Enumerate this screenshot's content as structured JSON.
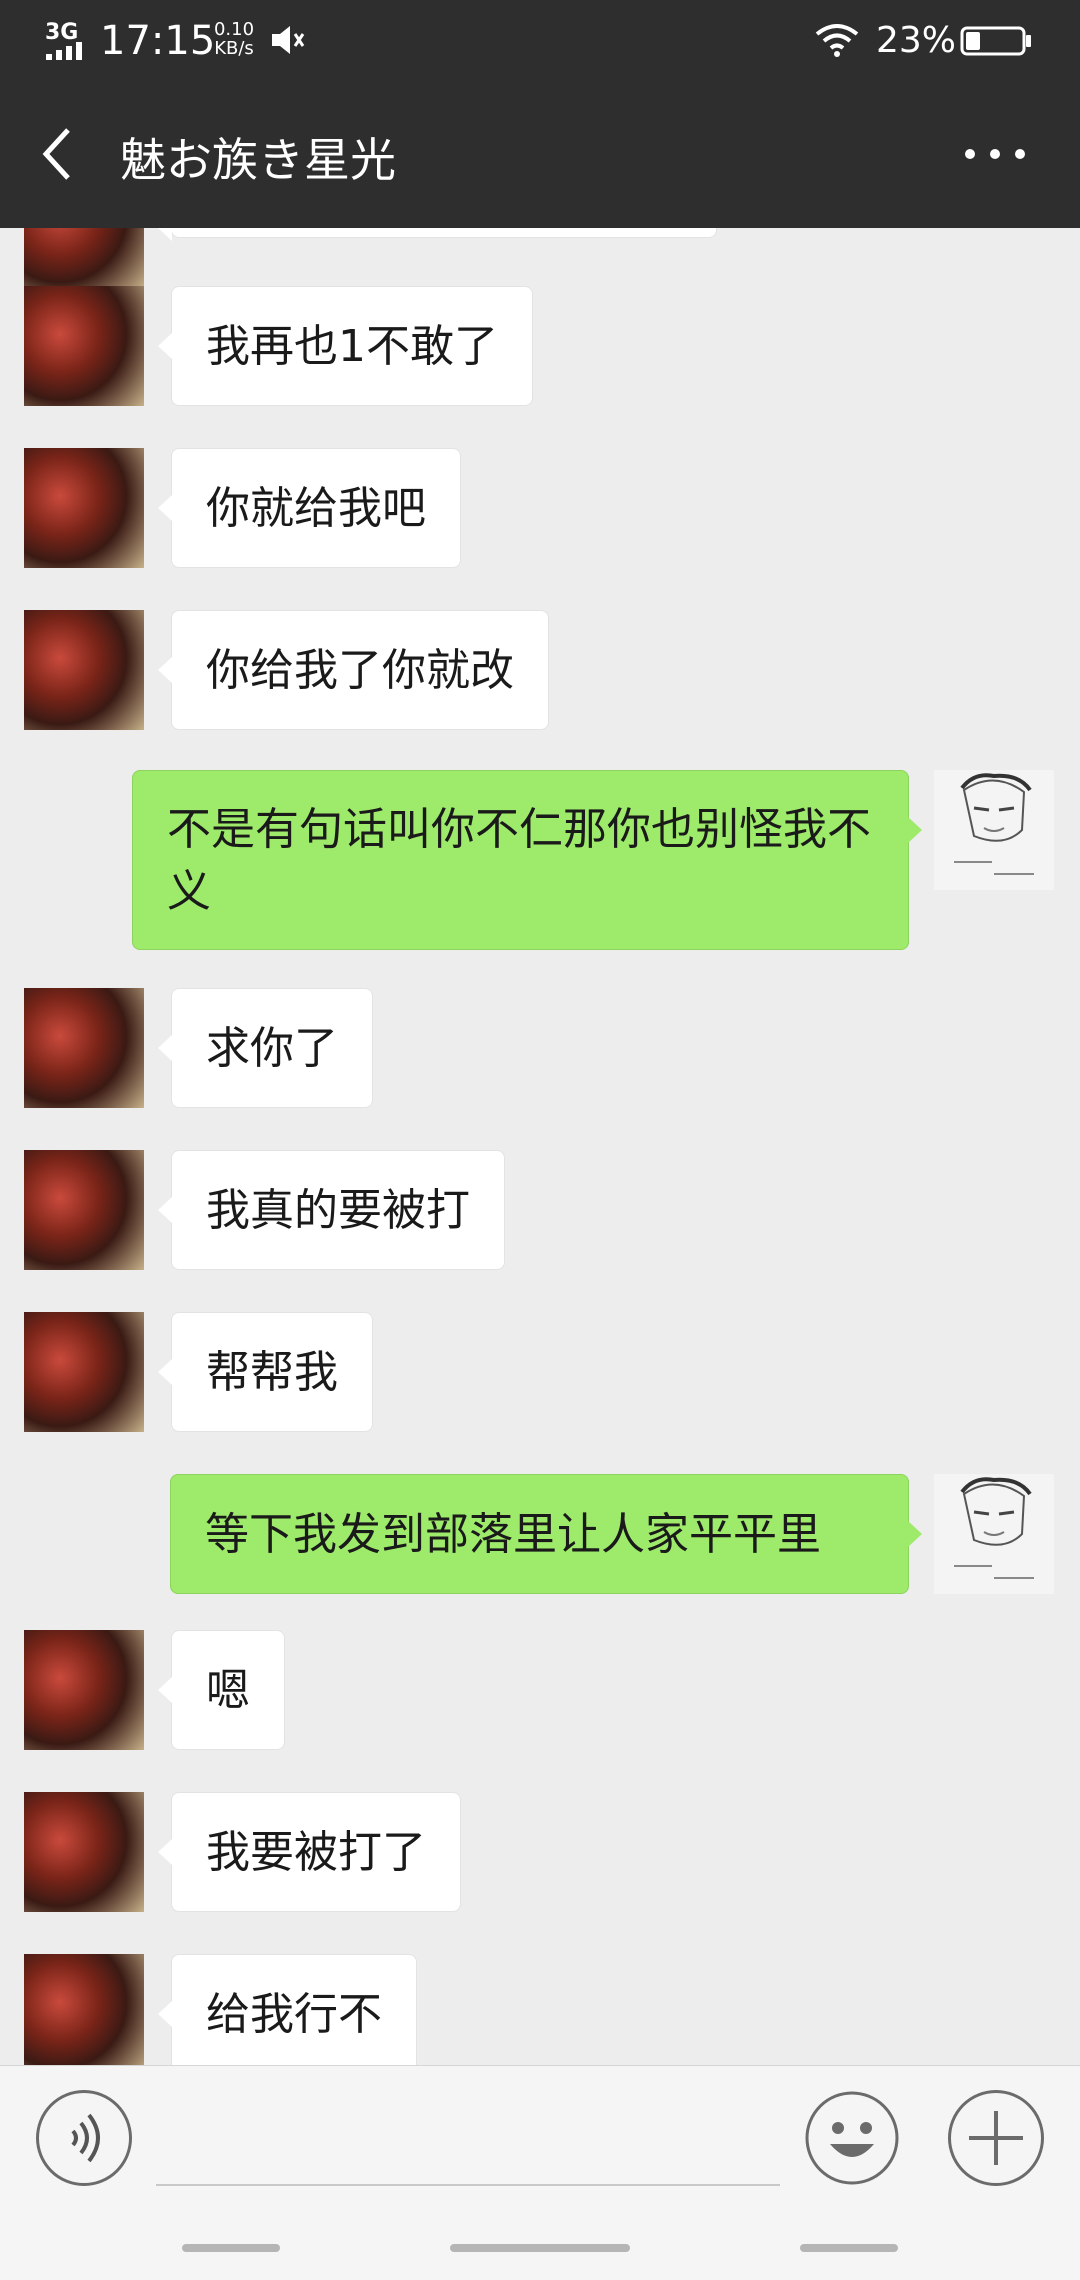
{
  "status_bar": {
    "network": "3G",
    "time": "17:15",
    "speed_value": "0.10",
    "speed_unit": "KB/s",
    "battery": "23%"
  },
  "title_bar": {
    "title": "魅お族き星光",
    "back_icon": "chevron-left-icon",
    "more_icon": "more-dots-icon"
  },
  "messages": [
    {
      "side": "in",
      "text": "我再也1不敢了"
    },
    {
      "side": "in",
      "text": "你就给我吧"
    },
    {
      "side": "in",
      "text": "你给我了你就改"
    },
    {
      "side": "out",
      "text": "不是有句话叫你不仁那你也别怪我不义"
    },
    {
      "side": "in",
      "text": "求你了"
    },
    {
      "side": "in",
      "text": "我真的要被打"
    },
    {
      "side": "in",
      "text": "帮帮我"
    },
    {
      "side": "out",
      "text": "等下我发到部落里让人家平平里"
    },
    {
      "side": "in",
      "text": "嗯"
    },
    {
      "side": "in",
      "text": "我要被打了"
    },
    {
      "side": "in",
      "text": "给我行不"
    }
  ],
  "input_bar": {
    "voice_icon": "voice-icon",
    "emoji_icon": "emoji-icon",
    "plus_icon": "plus-icon",
    "input_value": ""
  },
  "colors": {
    "header_bg": "#2e2e2e",
    "chat_bg": "#ededed",
    "outgoing_bubble": "#9eea6a",
    "incoming_bubble": "#ffffff"
  }
}
